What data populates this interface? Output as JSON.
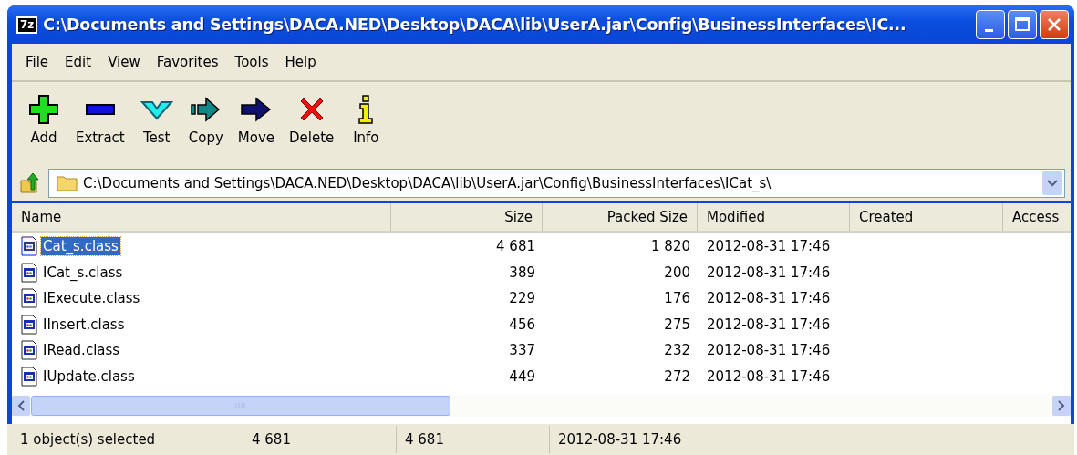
{
  "window": {
    "title": "C:\\Documents and Settings\\DACA.NED\\Desktop\\DACA\\lib\\UserA.jar\\Config\\BusinessInterfaces\\IC...",
    "app_badge": "7z"
  },
  "menu": [
    {
      "label": "File"
    },
    {
      "label": "Edit"
    },
    {
      "label": "View"
    },
    {
      "label": "Favorites"
    },
    {
      "label": "Tools"
    },
    {
      "label": "Help"
    }
  ],
  "toolbar": [
    {
      "kind": "add",
      "label": "Add"
    },
    {
      "kind": "extract",
      "label": "Extract"
    },
    {
      "kind": "test",
      "label": "Test"
    },
    {
      "kind": "copy",
      "label": "Copy"
    },
    {
      "kind": "move",
      "label": "Move"
    },
    {
      "kind": "delete",
      "label": "Delete"
    },
    {
      "kind": "info",
      "label": "Info"
    }
  ],
  "address": {
    "value": "C:\\Documents and Settings\\DACA.NED\\Desktop\\DACA\\lib\\UserA.jar\\Config\\BusinessInterfaces\\ICat_s\\"
  },
  "table": {
    "columns": [
      {
        "label": "Name"
      },
      {
        "label": "Size"
      },
      {
        "label": "Packed Size"
      },
      {
        "label": "Modified"
      },
      {
        "label": "Created"
      },
      {
        "label": "Access"
      }
    ],
    "rows": [
      {
        "name": "Cat_s.class",
        "size": "4 681",
        "packed": "1 820",
        "modified": "2012-08-31 17:46",
        "selected": true
      },
      {
        "name": "ICat_s.class",
        "size": "389",
        "packed": "200",
        "modified": "2012-08-31 17:46",
        "selected": false
      },
      {
        "name": "IExecute.class",
        "size": "229",
        "packed": "176",
        "modified": "2012-08-31 17:46",
        "selected": false
      },
      {
        "name": "IInsert.class",
        "size": "456",
        "packed": "275",
        "modified": "2012-08-31 17:46",
        "selected": false
      },
      {
        "name": "IRead.class",
        "size": "337",
        "packed": "232",
        "modified": "2012-08-31 17:46",
        "selected": false
      },
      {
        "name": "IUpdate.class",
        "size": "449",
        "packed": "272",
        "modified": "2012-08-31 17:46",
        "selected": false
      }
    ]
  },
  "status_bar": [
    "1 object(s) selected",
    "4 681",
    "4 681",
    "2012-08-31 17:46"
  ]
}
